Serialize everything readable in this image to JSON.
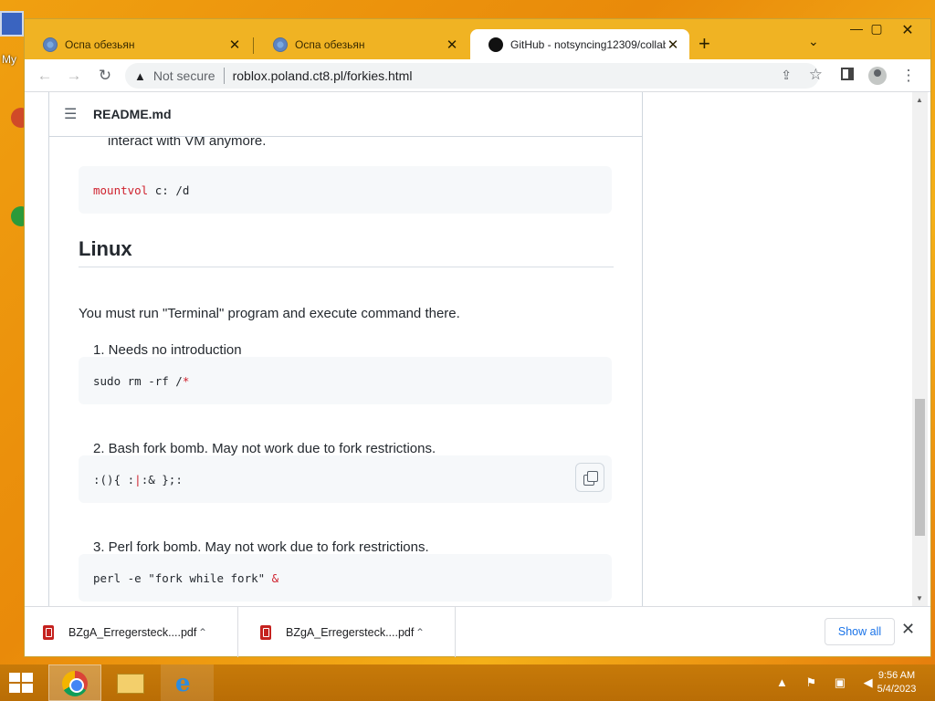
{
  "desktop": {
    "icon_label": "My"
  },
  "window": {
    "tabs": [
      {
        "title": "Оспа обезьян",
        "close": "✕"
      },
      {
        "title": "Оспа обезьян",
        "close": "✕"
      },
      {
        "title": "GitHub - notsyncing12309/collab",
        "close": "✕"
      }
    ],
    "new_tab": "+",
    "tab_search": "⌄",
    "controls": {
      "minimize": "—",
      "maximize": "▢",
      "close": "✕"
    }
  },
  "toolbar": {
    "back": "←",
    "forward": "→",
    "reload": "↻",
    "security_icon": "▲",
    "security_label": "Not secure",
    "url": "roblox.poland.ct8.pl/forkies.html",
    "share": "⇪",
    "star": "☆",
    "menu": "⋮"
  },
  "readme": {
    "header_icon": "☰",
    "header_title": "README.md",
    "partial_text": "interact with VM anymore.",
    "code1": {
      "kw": "mountvol",
      "rest": " c: /d"
    },
    "heading": "Linux",
    "intro": "You must run \"Terminal\" program and execute command there.",
    "item1": "1. Needs no introduction",
    "code2": {
      "plain": "sudo rm -rf /",
      "kw": "*"
    },
    "item2": "2. Bash fork bomb. May not work due to fork restrictions.",
    "code3": {
      "a": ":(){ :",
      "caret": "|",
      "b": ":& };:"
    },
    "item3": "3. Perl fork bomb. May not work due to fork restrictions.",
    "code4": {
      "plain": "perl -e \"fork while fork\" ",
      "kw": "&"
    }
  },
  "downloads": {
    "items": [
      {
        "name": "BZgA_Erregersteck....pdf",
        "chevron": "⌃"
      },
      {
        "name": "BZgA_Erregersteck....pdf",
        "chevron": "⌃"
      }
    ],
    "show_all": "Show all",
    "close": "✕"
  },
  "taskbar": {
    "tray_icons": "▲ ⚑ ▣ ◀",
    "time": "9:56 AM",
    "date": "5/4/2023"
  }
}
